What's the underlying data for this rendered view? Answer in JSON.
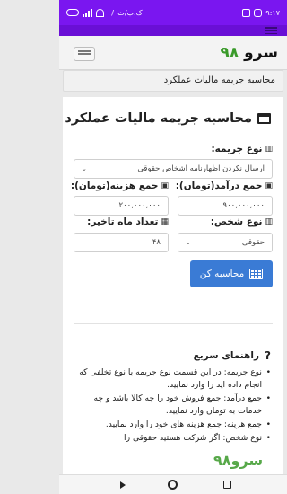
{
  "status": {
    "time": "۹:۱۷",
    "speed": "۰/۰ک.ب/ث",
    "battery": ""
  },
  "header": {
    "brand_number": "۹۸",
    "brand_text": "سرو"
  },
  "breadcrumb": "محاسبه جریمه مالیات عملکرد",
  "form": {
    "title": "محاسبه جریمه مالیات عملکرد",
    "penalty_type_label": "نوع جریمه:",
    "penalty_type_value": "ارسال نکردن اظهارنامه اشخاص حقوقی",
    "income_label": "جمع درآمد(تومان):",
    "income_value": "۹۰۰,۰۰۰,۰۰۰",
    "expense_label": "جمع هزینه(تومان):",
    "expense_value": "۲۰۰,۰۰۰,۰۰۰",
    "person_type_label": "نوع شخص:",
    "person_type_value": "حقوقی",
    "delay_months_label": "تعداد ماه تاخیر:",
    "delay_months_value": "۴۸",
    "calculate_button": "محاسبه کن"
  },
  "guide": {
    "title": "راهنمای سریع",
    "items": [
      "نوع جریمه: در این قسمت نوع جریمه یا نوع تخلفی که انجام داده اید را وارد نمایید.",
      "جمع درآمد: جمع فروش خود را چه کالا باشد و چه خدمات به تومان وارد نمایید.",
      "جمع هزینه: جمع هزینه های خود را وارد نمایید.",
      "نوع شخص: اگر شرکت هستید حقوقی را"
    ]
  },
  "watermark": "سرو۹۸",
  "colors": {
    "status_bar": "#7a16f0",
    "brand_green": "#3a9a2a",
    "button_blue": "#3a7bd5"
  }
}
